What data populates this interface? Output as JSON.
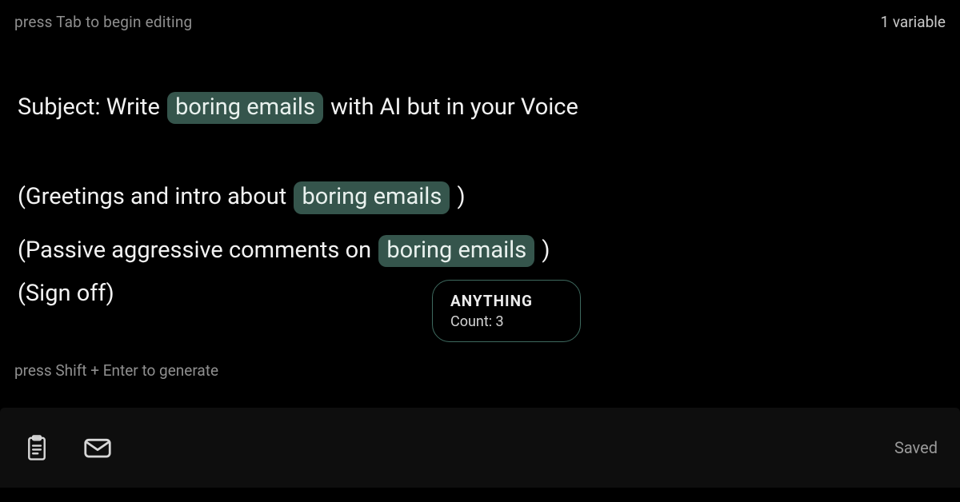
{
  "top": {
    "edit_hint": "press Tab to begin editing",
    "variable_label": "1 variable"
  },
  "content": {
    "subject_prefix": "Subject: Write ",
    "subject_suffix": " with AI but in your Voice",
    "chip_text": "boring emails",
    "greet_prefix": "(Greetings and intro about ",
    "greet_suffix": " )",
    "passive_prefix": "(Passive aggressive comments on ",
    "passive_suffix": " )",
    "signoff": "(Sign off)"
  },
  "tooltip": {
    "title": "ANYTHING",
    "count_label": "Count: 3"
  },
  "bottom": {
    "generate_hint": "press Shift + Enter to generate",
    "saved_label": "Saved"
  }
}
